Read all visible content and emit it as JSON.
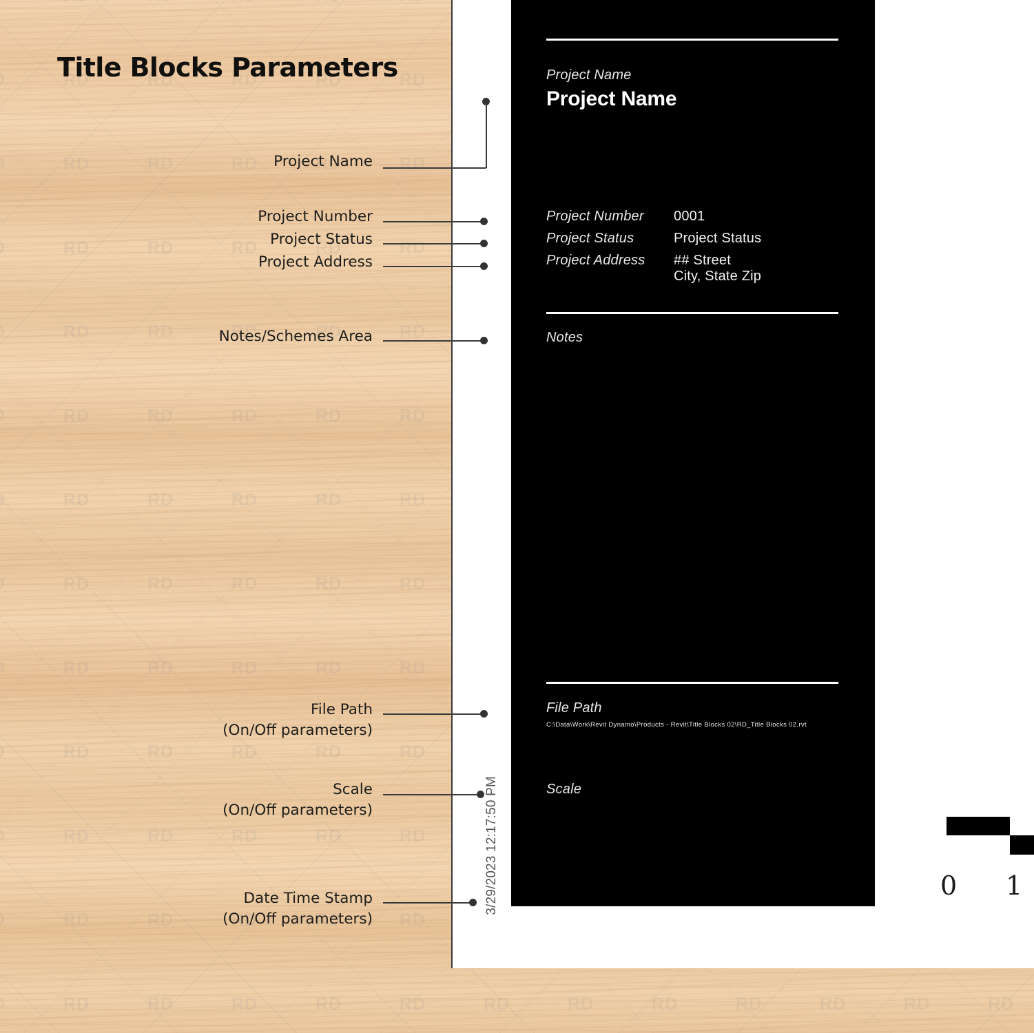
{
  "page": {
    "title": "Title Blocks Parameters",
    "background": "wood-texture",
    "watermark_text": "RD"
  },
  "callouts": [
    {
      "id": "project-name",
      "label": "Project Name",
      "sub": ""
    },
    {
      "id": "project-number",
      "label": "Project Number",
      "sub": ""
    },
    {
      "id": "project-status",
      "label": "Project Status",
      "sub": ""
    },
    {
      "id": "project-address",
      "label": "Project Address",
      "sub": ""
    },
    {
      "id": "notes-area",
      "label": "Notes/Schemes Area",
      "sub": ""
    },
    {
      "id": "file-path",
      "label": "File Path",
      "sub": "(On/Off parameters)"
    },
    {
      "id": "scale",
      "label": "Scale",
      "sub": "(On/Off parameters)"
    },
    {
      "id": "date-time-stamp",
      "label": "Date Time Stamp",
      "sub": "(On/Off parameters)"
    }
  ],
  "sheet": {
    "date_stamp": "3/29/2023 12:17:50 PM"
  },
  "titleblock": {
    "project_name_label": "Project Name",
    "project_name_value": "Project Name",
    "project_number_label": "Project Number",
    "project_number_value": "0001",
    "project_status_label": "Project Status",
    "project_status_value": "Project  Status",
    "project_address_label": "Project Address",
    "project_address_line1": "## Street",
    "project_address_line2": "City, State  Zip",
    "notes_label": "Notes",
    "file_path_label": "File Path",
    "file_path_value": "C:\\Data\\Work\\Revit Dynamo\\Products - Revit\\Title Blocks 02\\RD_Title Blocks 02.rvt",
    "scale_label": "Scale"
  },
  "scalebar": {
    "start": "0",
    "end": "1"
  },
  "colors": {
    "wood": "#e9c6a0",
    "sheet": "#ffffff",
    "titleblock": "#000000",
    "text_dark": "#1d1d1b",
    "leader": "#3b3b3b"
  }
}
